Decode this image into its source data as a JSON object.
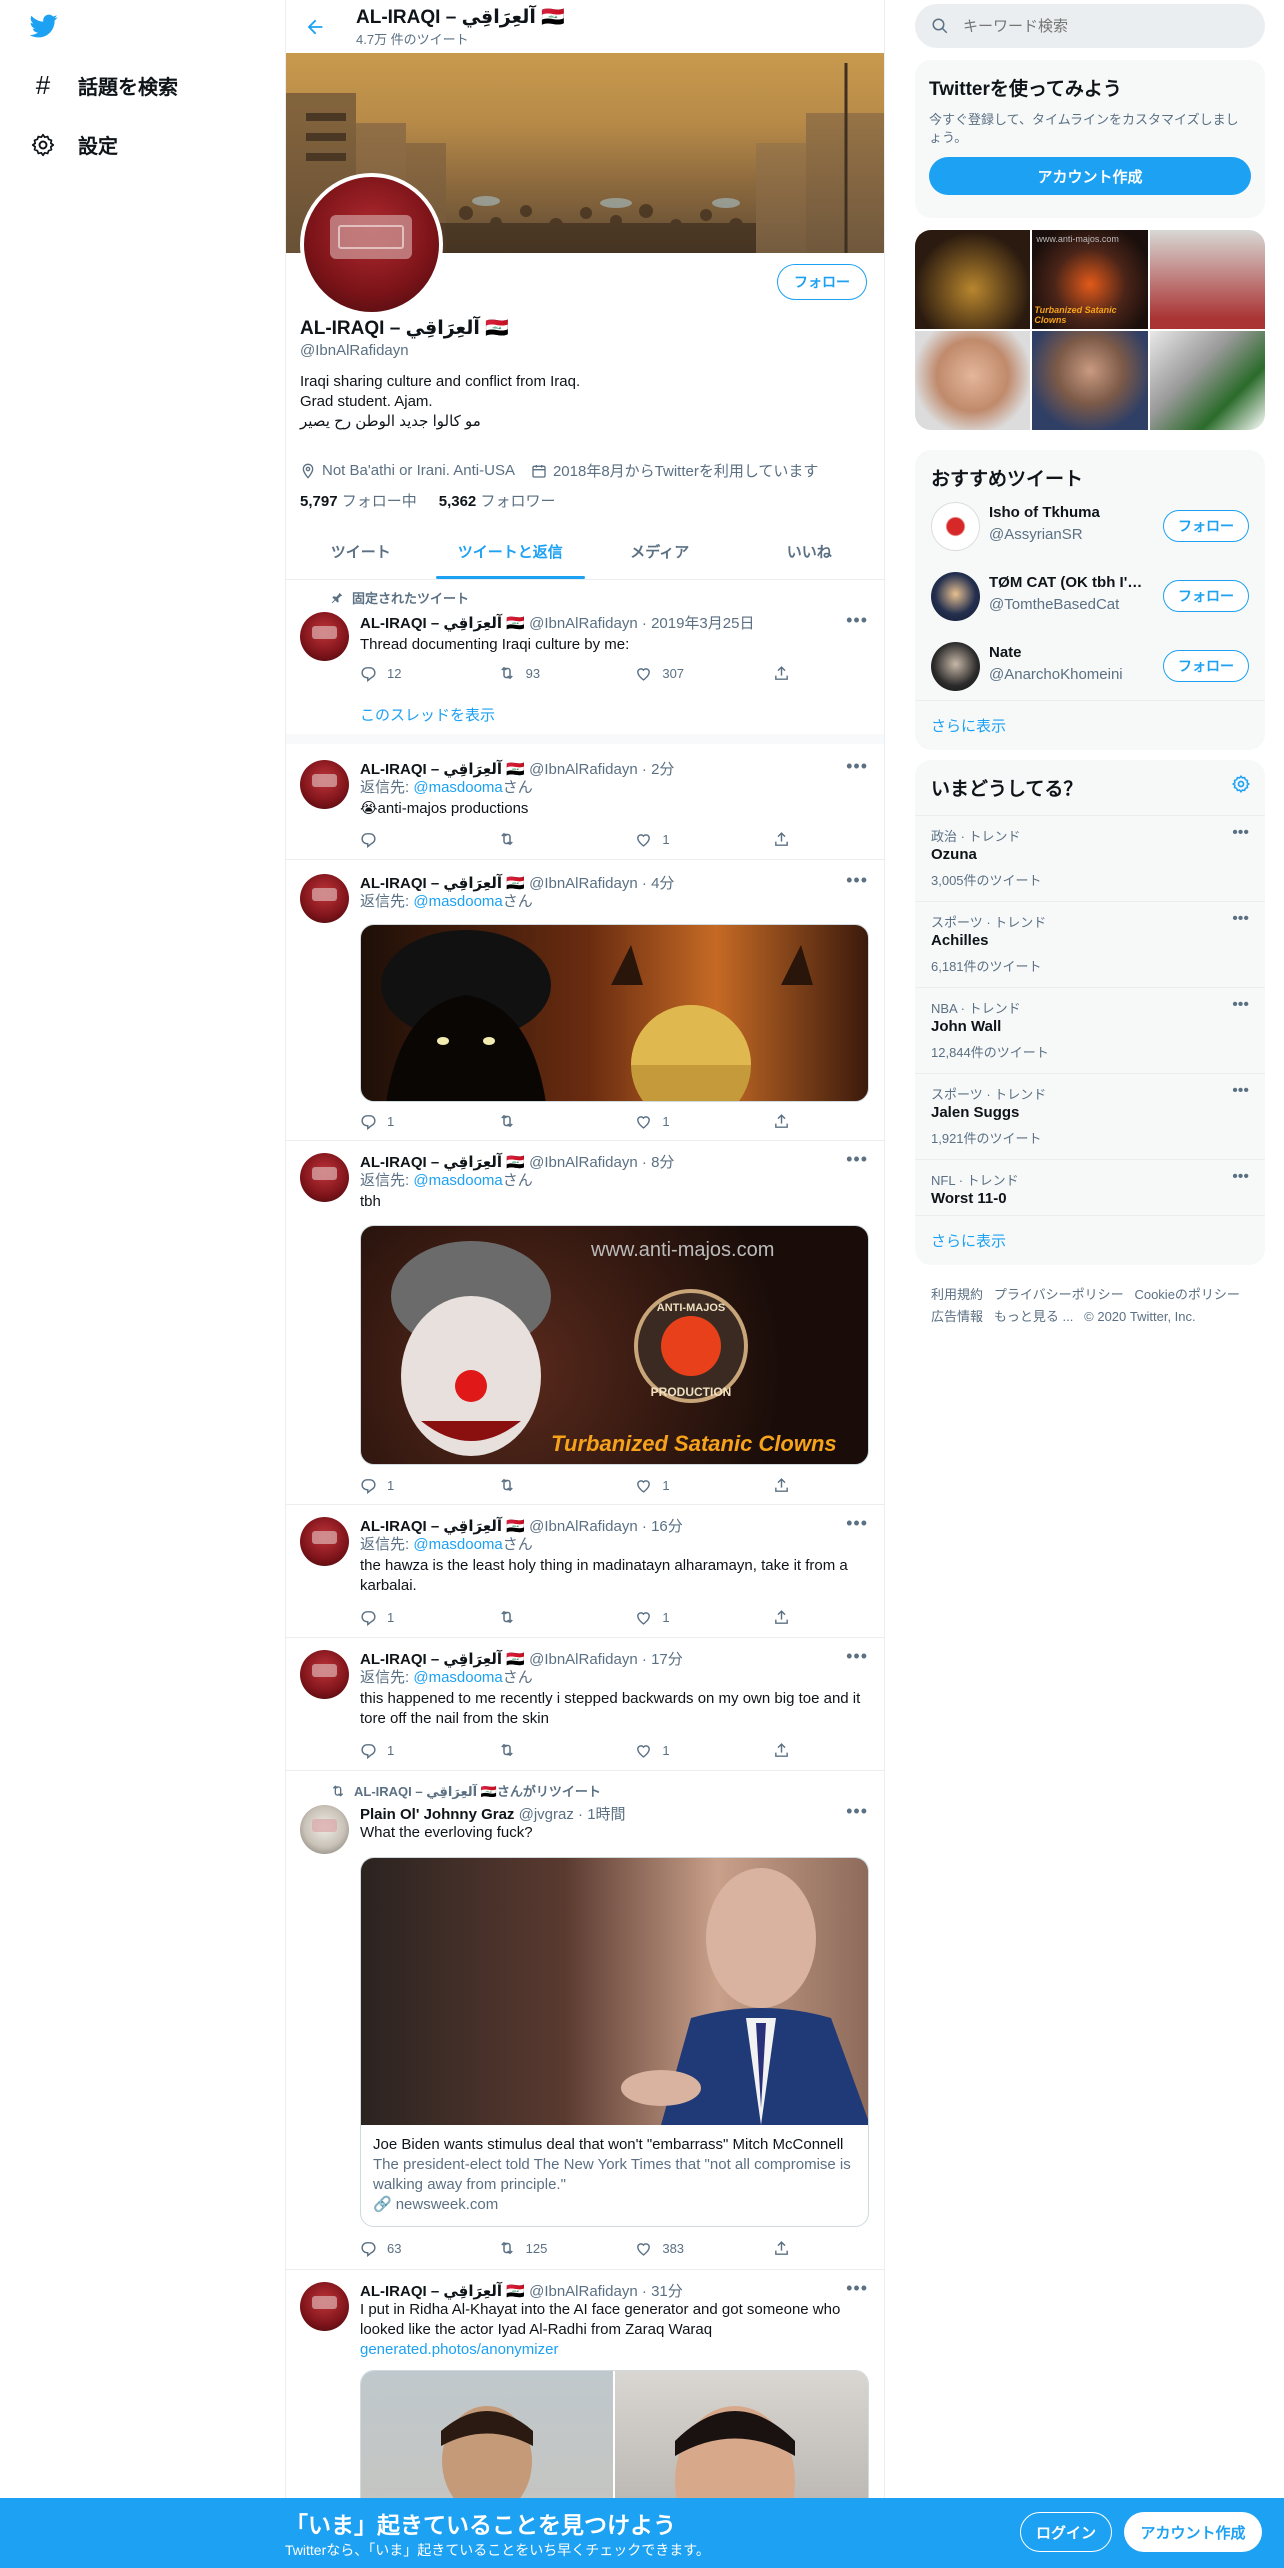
{
  "left_nav": {
    "items": [
      {
        "label": "話題を検索",
        "icon": "hashtag-icon"
      },
      {
        "label": "設定",
        "icon": "gear-icon"
      }
    ]
  },
  "profile": {
    "name": "AL-IRAQI – آلعِرَاقِي 🇮🇶",
    "tweet_count": "4.7万 件のツイート",
    "handle": "@IbnAlRafidayn",
    "follow_label": "フォロー",
    "bio": [
      "Iraqi sharing culture and conflict from Iraq.",
      "Grad student. Ajam.",
      "مو كالوا جديد الوطن رح يصير"
    ],
    "location": "Not Ba'athi or Irani. Anti-USA",
    "joined": "2018年8月からTwitterを利用しています",
    "following_count": "5,797",
    "following_label": "フォロー中",
    "followers_count": "5,362",
    "followers_label": "フォロワー"
  },
  "tabs": [
    "ツイート",
    "ツイートと返信",
    "メディア",
    "いいね"
  ],
  "pinned_label": "固定されたツイート",
  "retweet_label": "AL-IRAQI – آلعِرَاقِي 🇮🇶さんがリツイート",
  "reply_prefix": "返信先: ",
  "reply_target": "@masdooma",
  "reply_suffix": "さん",
  "show_thread": "このスレッドを表示",
  "tweets": [
    {
      "name": "AL-IRAQI – آلعِرَاقِي 🇮🇶",
      "handle": "@IbnAlRafidayn",
      "time": "2019年3月25日",
      "text": "Thread documenting Iraqi culture by me:",
      "replies": "12",
      "retweets": "93",
      "likes": "307"
    },
    {
      "name": "AL-IRAQI – آلعِرَاقِي 🇮🇶",
      "handle": "@IbnAlRafidayn",
      "time": "2分",
      "text": "😭anti-majos productions",
      "replies": "",
      "retweets": "",
      "likes": "1"
    },
    {
      "name": "AL-IRAQI – آلعِرَاقِي 🇮🇶",
      "handle": "@IbnAlRafidayn",
      "time": "4分",
      "text": "",
      "replies": "1",
      "retweets": "",
      "likes": "1"
    },
    {
      "name": "AL-IRAQI – آلعِرَاقِي 🇮🇶",
      "handle": "@IbnAlRafidayn",
      "time": "8分",
      "text": "tbh",
      "replies": "1",
      "retweets": "",
      "likes": "1",
      "image_text": [
        "www.anti-majos.com",
        "ANTI-MAJOS",
        "PRODUCTION",
        "Turbanized Satanic Clowns"
      ]
    },
    {
      "name": "AL-IRAQI – آلعِرَاقِي 🇮🇶",
      "handle": "@IbnAlRafidayn",
      "time": "16分",
      "text": "the hawza is the least holy thing in madinatayn alharamayn, take it from a karbalai.",
      "replies": "1",
      "retweets": "",
      "likes": "1"
    },
    {
      "name": "AL-IRAQI – آلعِرَاقِي 🇮🇶",
      "handle": "@IbnAlRafidayn",
      "time": "17分",
      "text": "this happened to me recently i stepped backwards on my own big toe and it tore off the nail from the skin",
      "replies": "1",
      "retweets": "",
      "likes": "1"
    },
    {
      "name": "Plain Ol' Johnny Graz",
      "handle": "@jvgraz",
      "time": "1時間",
      "text": "What the everloving fuck?",
      "replies": "63",
      "retweets": "125",
      "likes": "383",
      "card_title": "Joe Biden wants stimulus deal that won't \"embarrass\" Mitch McConnell",
      "card_desc": "The president-elect told The New York Times that \"not all compromise is walking away from principle.\"",
      "card_domain": "newsweek.com"
    },
    {
      "name": "AL-IRAQI – آلعِرَاقِي 🇮🇶",
      "handle": "@IbnAlRafidayn",
      "time": "31分",
      "text": "I put in Ridha Al-Khayat into the AI face generator and got someone who looked like the actor Iyad Al-Radhi from Zaraq Waraq",
      "link": "generated.photos/anonymizer"
    }
  ],
  "search": {
    "placeholder": "キーワード検索"
  },
  "signup": {
    "title": "Twitterを使ってみよう",
    "desc": "今すぐ登録して、タイムラインをカスタマイズしましょう。",
    "button": "アカウント作成"
  },
  "media_grid_text": [
    "www.anti-majos.com",
    "Turbanized Satanic Clowns"
  ],
  "who_to_follow": {
    "title": "おすすめツイート",
    "items": [
      {
        "name": "Isho of Tkhuma",
        "handle": "@AssyrianSR"
      },
      {
        "name": "TØM CAT (OK tbh I'…",
        "handle": "@TomtheBasedCat"
      },
      {
        "name": "Nate",
        "handle": "@AnarchoKhomeini"
      }
    ],
    "more": "さらに表示",
    "follow": "フォロー"
  },
  "trends": {
    "title": "いまどうしてる？",
    "items": [
      {
        "category": "政治 · トレンド",
        "name": "Ozuna",
        "count": "3,005件のツイート"
      },
      {
        "category": "スポーツ · トレンド",
        "name": "Achilles",
        "count": "6,181件のツイート"
      },
      {
        "category": "NBA · トレンド",
        "name": "John Wall",
        "count": "12,844件のツイート"
      },
      {
        "category": "スポーツ · トレンド",
        "name": "Jalen Suggs",
        "count": "1,921件のツイート"
      },
      {
        "category": "NFL · トレンド",
        "name": "Worst 11-0",
        "count": ""
      }
    ],
    "more": "さらに表示"
  },
  "footer": {
    "links": [
      "利用規約",
      "プライバシーポリシー",
      "Cookieのポリシー",
      "広告情報",
      "もっと見る ..."
    ],
    "copyright": "© 2020 Twitter, Inc."
  },
  "bottom_bar": {
    "title": "「いま」起きていることを見つけよう",
    "subtitle": "Twitterなら、「いま」起きていることをいち早くチェックできます。",
    "login": "ログイン",
    "signup": "アカウント作成"
  },
  "colors": {
    "accent": "#1da1f2",
    "text": "#0f1419",
    "secondary": "#5b7083",
    "border": "#ebeef0"
  }
}
